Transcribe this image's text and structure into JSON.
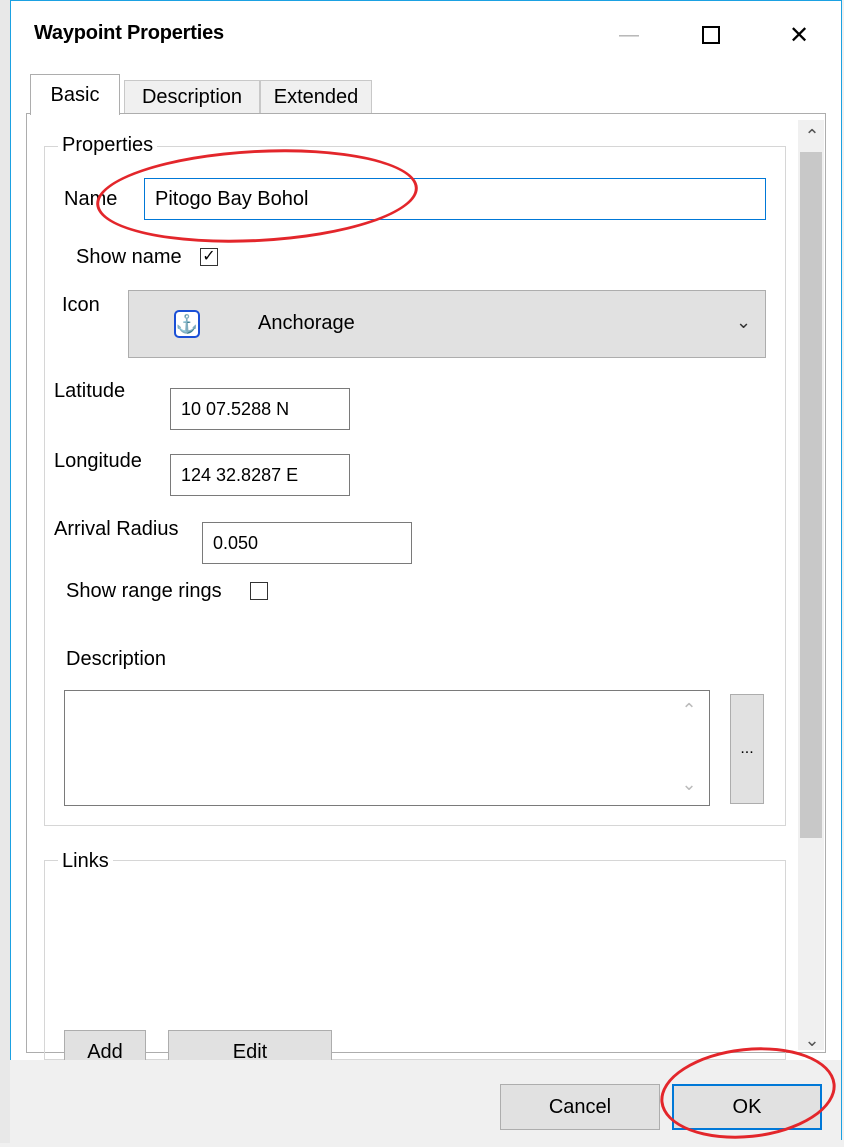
{
  "window": {
    "title": "Waypoint Properties",
    "minimize_glyph": "—",
    "maximize_glyph": "☐",
    "close_glyph": "✕"
  },
  "tabs": [
    {
      "label": "Basic",
      "active": true
    },
    {
      "label": "Description",
      "active": false
    },
    {
      "label": "Extended",
      "active": false
    }
  ],
  "properties": {
    "group_label": "Properties",
    "name_label": "Name",
    "name_value": "Pitogo Bay Bohol",
    "show_name_label": "Show name",
    "show_name_checked": true,
    "icon_label": "Icon",
    "icon_value": "Anchorage",
    "icon_name": "anchor-icon",
    "latitude_label": "Latitude",
    "latitude_value": "10 07.5288 N",
    "longitude_label": "Longitude",
    "longitude_value": "124 32.8287 E",
    "arrival_radius_label": "Arrival Radius",
    "arrival_radius_value": "0.050",
    "show_range_rings_label": "Show range rings",
    "show_range_rings_checked": false,
    "description_label": "Description",
    "description_value": "",
    "ellipsis_label": "..."
  },
  "links": {
    "group_label": "Links",
    "add_label": "Add",
    "edit_label": "Edit"
  },
  "footer": {
    "cancel_label": "Cancel",
    "ok_label": "OK"
  },
  "colors": {
    "accent": "#0078d7",
    "annotation": "#e3262b",
    "window_border": "#1ba1e2"
  }
}
